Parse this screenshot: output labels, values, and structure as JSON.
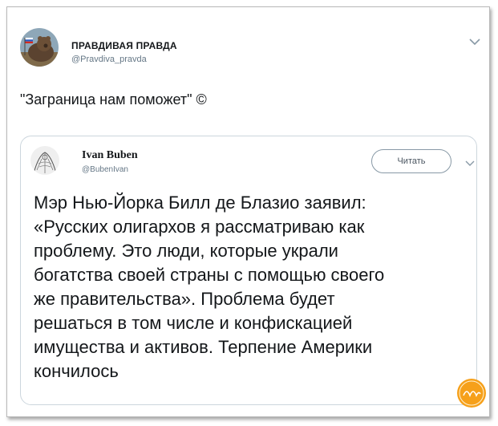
{
  "author": {
    "name": "ПРАВДИВАЯ ПРАВДА",
    "handle": "@Pravdiva_pravda"
  },
  "tweet": {
    "text": "\"Заграница нам поможет\" ©"
  },
  "quoted": {
    "name": "Ivan Buben",
    "handle": "@BubenIvan",
    "follow_label": "Читать",
    "body": "Мэр Нью-Йорка Билл де Блазио заявил:\n«Русских олигархов я рассматриваю как\nпроблему. Это люди, которые украли\nбогатства своей страны с помощью своего\nже правительства». Проблема будет\nрешаться в том числе и конфискацией\nимущества и активов. Терпение Америки\nкончилось"
  },
  "colors": {
    "text": "#14171a",
    "secondary": "#657786",
    "border": "#ccd6dd",
    "watermark": "#f6a01a"
  },
  "icons": {
    "caret": "chevron-down-icon",
    "avatar": "bear-avatar",
    "quoted_avatar": "sketch-avatar",
    "watermark": "logo-watermark"
  }
}
